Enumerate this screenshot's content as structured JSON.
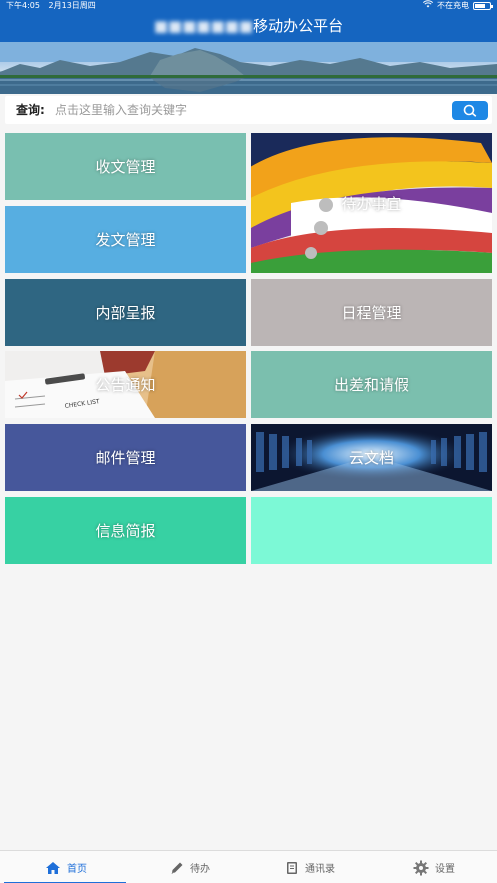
{
  "status_bar": {
    "time": "下午4:05",
    "date": "2月13日周四",
    "charging": "不在充电"
  },
  "header": {
    "title_prefix": "■■■■■■■",
    "title": "移动办公平台"
  },
  "search": {
    "label": "查询:",
    "placeholder": "点击这里输入查询关键字"
  },
  "tiles": [
    {
      "label": "收文管理",
      "color": "#79bfb0"
    },
    {
      "label": "待办事宜",
      "color": "#6b6b6b"
    },
    {
      "label": "发文管理",
      "color": "#57aee1"
    },
    {
      "label": "内部呈报",
      "color": "#2f6682"
    },
    {
      "label": "日程管理",
      "color": "#bbb5b5"
    },
    {
      "label": "公告通知",
      "color": "#d9a256"
    },
    {
      "label": "出差和请假",
      "color": "#7bbfae"
    },
    {
      "label": "邮件管理",
      "color": "#46579b"
    },
    {
      "label": "云文档",
      "color": "#1c2a46"
    },
    {
      "label": "信息简报",
      "color": "#37d1a3"
    },
    {
      "label": "",
      "color": "#7cf9d6"
    }
  ],
  "tabbar": [
    {
      "label": "首页",
      "icon": "home-icon",
      "active": true
    },
    {
      "label": "待办",
      "icon": "pencil-icon",
      "active": false
    },
    {
      "label": "通讯录",
      "icon": "address-book-icon",
      "active": false
    },
    {
      "label": "设置",
      "icon": "gear-icon",
      "active": false
    }
  ]
}
